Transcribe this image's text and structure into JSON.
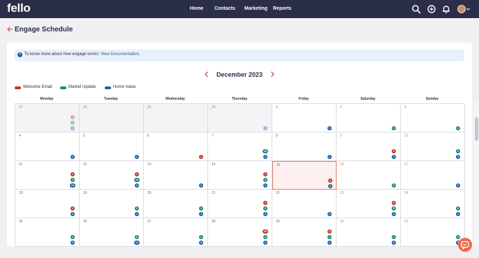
{
  "brand": {
    "logo": "fello"
  },
  "nav": {
    "links": [
      "Home",
      "Contacts",
      "Marketing",
      "Reports"
    ]
  },
  "page": {
    "title": "Engage Schedule"
  },
  "info": {
    "text": "To know more about how engage works: ",
    "link": "View Documentation",
    "end": "."
  },
  "calendar": {
    "month_label": "December 2023",
    "weekdays": [
      "Monday",
      "Tuesday",
      "Wednesday",
      "Thursday",
      "Friday",
      "Saturday",
      "Sunday"
    ],
    "legend": [
      {
        "label": "Welcome Email",
        "color": "#c0392b"
      },
      {
        "label": "Market Update",
        "color": "#1f8a70"
      },
      {
        "label": "Home Value",
        "color": "#1f5fa3"
      }
    ],
    "weeks": [
      [
        {
          "day": "27",
          "other": true,
          "badges": []
        },
        {
          "day": "28",
          "other": true,
          "badges": []
        },
        {
          "day": "29",
          "other": true,
          "badges": []
        },
        {
          "day": "30",
          "other": true,
          "badges": []
        },
        {
          "day": "1",
          "badges": []
        },
        {
          "day": "2",
          "badges": []
        },
        {
          "day": "3",
          "badges": []
        }
      ],
      [
        {
          "day": "4",
          "badges": []
        },
        {
          "day": "5",
          "badges": []
        },
        {
          "day": "6",
          "badges": []
        },
        {
          "day": "7",
          "badges": []
        },
        {
          "day": "8",
          "badges": []
        },
        {
          "day": "9",
          "badges": []
        },
        {
          "day": "10",
          "badges": []
        }
      ],
      [
        {
          "day": "11",
          "badges": []
        },
        {
          "day": "12",
          "badges": []
        },
        {
          "day": "13",
          "badges": []
        },
        {
          "day": "14",
          "badges": []
        },
        {
          "day": "15",
          "today": true,
          "badges": []
        },
        {
          "day": "16",
          "badges": []
        },
        {
          "day": "17",
          "badges": []
        }
      ],
      [
        {
          "day": "18",
          "badges": []
        },
        {
          "day": "19",
          "badges": []
        },
        {
          "day": "20",
          "badges": []
        },
        {
          "day": "21",
          "badges": []
        },
        {
          "day": "22",
          "badges": []
        },
        {
          "day": "23",
          "badges": []
        },
        {
          "day": "24",
          "badges": []
        }
      ],
      [
        {
          "day": "25",
          "badges": []
        },
        {
          "day": "26",
          "badges": []
        },
        {
          "day": "27",
          "badges": []
        },
        {
          "day": "28",
          "badges": []
        },
        {
          "day": "29",
          "badges": []
        },
        {
          "day": "30",
          "badges": []
        },
        {
          "day": "31",
          "badges": []
        }
      ]
    ],
    "badges": [
      [
        [
          [
            "w",
            "1"
          ],
          [
            "m",
            "1"
          ],
          [
            "h",
            "1"
          ]
        ],
        [],
        [],
        [
          [
            "h",
            "1"
          ]
        ],
        [
          [
            "h",
            "1"
          ]
        ],
        [
          [
            "m",
            "1"
          ]
        ],
        [
          [
            "m",
            "1"
          ]
        ]
      ],
      [
        [
          [
            "h",
            "1"
          ]
        ],
        [
          [
            "h",
            "1"
          ]
        ],
        [
          [
            "w",
            "1"
          ]
        ],
        [
          [
            "m",
            "10"
          ],
          [
            "h",
            "1"
          ]
        ],
        [
          [
            "h",
            "1"
          ]
        ],
        [
          [
            "w",
            "1"
          ],
          [
            "h",
            "1"
          ]
        ],
        [
          [
            "m",
            "1"
          ],
          [
            "h",
            "1"
          ]
        ]
      ],
      [
        [
          [
            "w",
            "1"
          ],
          [
            "m",
            "1"
          ],
          [
            "h",
            "10"
          ]
        ],
        [
          [
            "w",
            "1"
          ],
          [
            "m",
            "10"
          ],
          [
            "h",
            "2"
          ]
        ],
        [
          [
            "h",
            "1"
          ]
        ],
        [
          [
            "w",
            "1"
          ],
          [
            "m",
            "1"
          ],
          [
            "h",
            "1"
          ]
        ],
        [
          [
            "w",
            "1"
          ],
          [
            "h",
            "1"
          ]
        ],
        [
          [
            "m",
            "2"
          ]
        ],
        [
          [
            "h",
            "1"
          ]
        ]
      ],
      [
        [
          [
            "w",
            "1"
          ],
          [
            "h",
            "2"
          ]
        ],
        [
          [
            "m",
            "1"
          ],
          [
            "h",
            "1"
          ]
        ],
        [
          [
            "m",
            "1"
          ],
          [
            "h",
            "1"
          ]
        ],
        [
          [
            "w",
            "1"
          ],
          [
            "m",
            "2"
          ],
          [
            "h",
            "2"
          ]
        ],
        [
          [
            "h",
            "2"
          ]
        ],
        [
          [
            "w",
            "2"
          ],
          [
            "m",
            "5"
          ],
          [
            "h",
            "1"
          ]
        ],
        [
          [
            "m",
            "2"
          ],
          [
            "h",
            "2"
          ]
        ]
      ],
      [
        [
          [
            "m",
            "1"
          ],
          [
            "h",
            "2"
          ]
        ],
        [
          [
            "m",
            "3"
          ],
          [
            "h",
            "12"
          ]
        ],
        [
          [
            "m",
            "1"
          ],
          [
            "h",
            "3"
          ]
        ],
        [
          [
            "w",
            "29"
          ],
          [
            "m",
            "4"
          ],
          [
            "h",
            "2"
          ]
        ],
        [
          [
            "w",
            "1"
          ],
          [
            "m",
            "1"
          ],
          [
            "h",
            "2"
          ]
        ],
        [
          [
            "m",
            "1"
          ],
          [
            "h",
            "2"
          ]
        ],
        [
          [
            "m",
            "3"
          ],
          [
            "h",
            "4"
          ]
        ]
      ]
    ]
  },
  "icons": {
    "search": "search-icon",
    "add": "add-circle-icon",
    "bell": "bell-icon",
    "back": "back-arrow-icon",
    "info": "info-icon",
    "chat": "chat-icon"
  }
}
